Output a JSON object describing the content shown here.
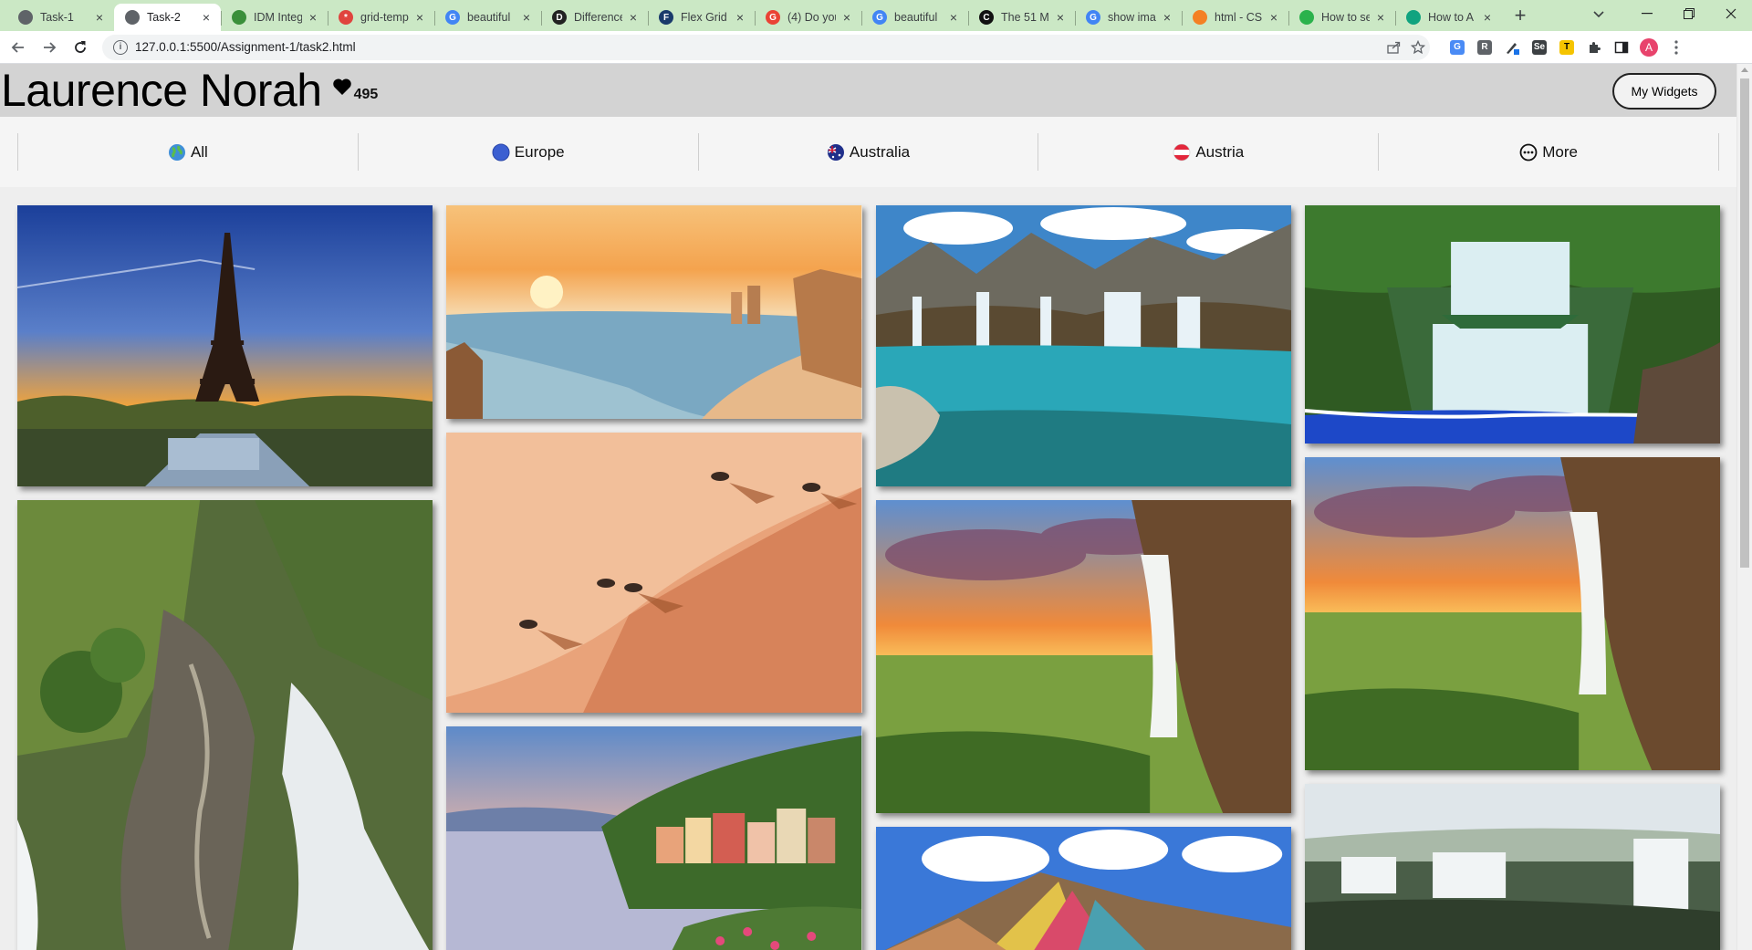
{
  "browser": {
    "tabs": [
      {
        "title": "Task-1",
        "favicon_color": "#5f6368",
        "favicon_glyph": "",
        "active": false
      },
      {
        "title": "Task-2",
        "favicon_color": "#5f6368",
        "favicon_glyph": "",
        "active": true
      },
      {
        "title": "IDM Integ",
        "favicon_color": "#3a8f3a",
        "favicon_glyph": "",
        "active": false
      },
      {
        "title": "grid-temp",
        "favicon_color": "#e0443e",
        "favicon_glyph": "*",
        "active": false
      },
      {
        "title": "beautiful",
        "favicon_color": "#4285f4",
        "favicon_glyph": "G",
        "active": false
      },
      {
        "title": "Difference",
        "favicon_color": "#222222",
        "favicon_glyph": "D",
        "active": false
      },
      {
        "title": "Flex Grid",
        "favicon_color": "#1a3a6b",
        "favicon_glyph": "F",
        "active": false
      },
      {
        "title": "(4) Do you",
        "favicon_color": "#ea4335",
        "favicon_glyph": "G",
        "active": false
      },
      {
        "title": "beautiful",
        "favicon_color": "#4285f4",
        "favicon_glyph": "G",
        "active": false
      },
      {
        "title": "The 51 M",
        "favicon_color": "#111111",
        "favicon_glyph": "C",
        "active": false
      },
      {
        "title": "show ima",
        "favicon_color": "#4285f4",
        "favicon_glyph": "G",
        "active": false
      },
      {
        "title": "html - CS",
        "favicon_color": "#f48024",
        "favicon_glyph": "",
        "active": false
      },
      {
        "title": "How to se",
        "favicon_color": "#2bb24c",
        "favicon_glyph": "",
        "active": false
      },
      {
        "title": "How to A",
        "favicon_color": "#10a37f",
        "favicon_glyph": "",
        "active": false
      }
    ],
    "url": "127.0.0.1:5500/Assignment-1/task2.html"
  },
  "page": {
    "title": "Laurence Norah",
    "likes": "495",
    "widgets_button": "My Widgets"
  },
  "filters": [
    {
      "label": "All",
      "icon": "globe-icon"
    },
    {
      "label": "Europe",
      "icon": "europe-globe-icon"
    },
    {
      "label": "Australia",
      "icon": "australia-flag-icon"
    },
    {
      "label": "Austria",
      "icon": "austria-flag-icon"
    },
    {
      "label": "More",
      "icon": "more-dots-icon"
    }
  ],
  "gallery": {
    "columns": [
      [
        {
          "scene": "eiffel-tower-sunset"
        },
        {
          "scene": "waterfall-stairway-jungle"
        }
      ],
      [
        {
          "scene": "coastal-cliffs-sunset"
        },
        {
          "scene": "desert-dunes-oryx"
        },
        {
          "scene": "lakeside-village"
        }
      ],
      [
        {
          "scene": "mountain-waterfall-pool"
        },
        {
          "scene": "cliff-waterfall-sunset"
        },
        {
          "scene": "rainbow-mountain"
        }
      ],
      [
        {
          "scene": "forest-waterfall"
        },
        {
          "scene": "cliff-waterfall-sunset"
        },
        {
          "scene": "misty-falls"
        }
      ]
    ]
  }
}
